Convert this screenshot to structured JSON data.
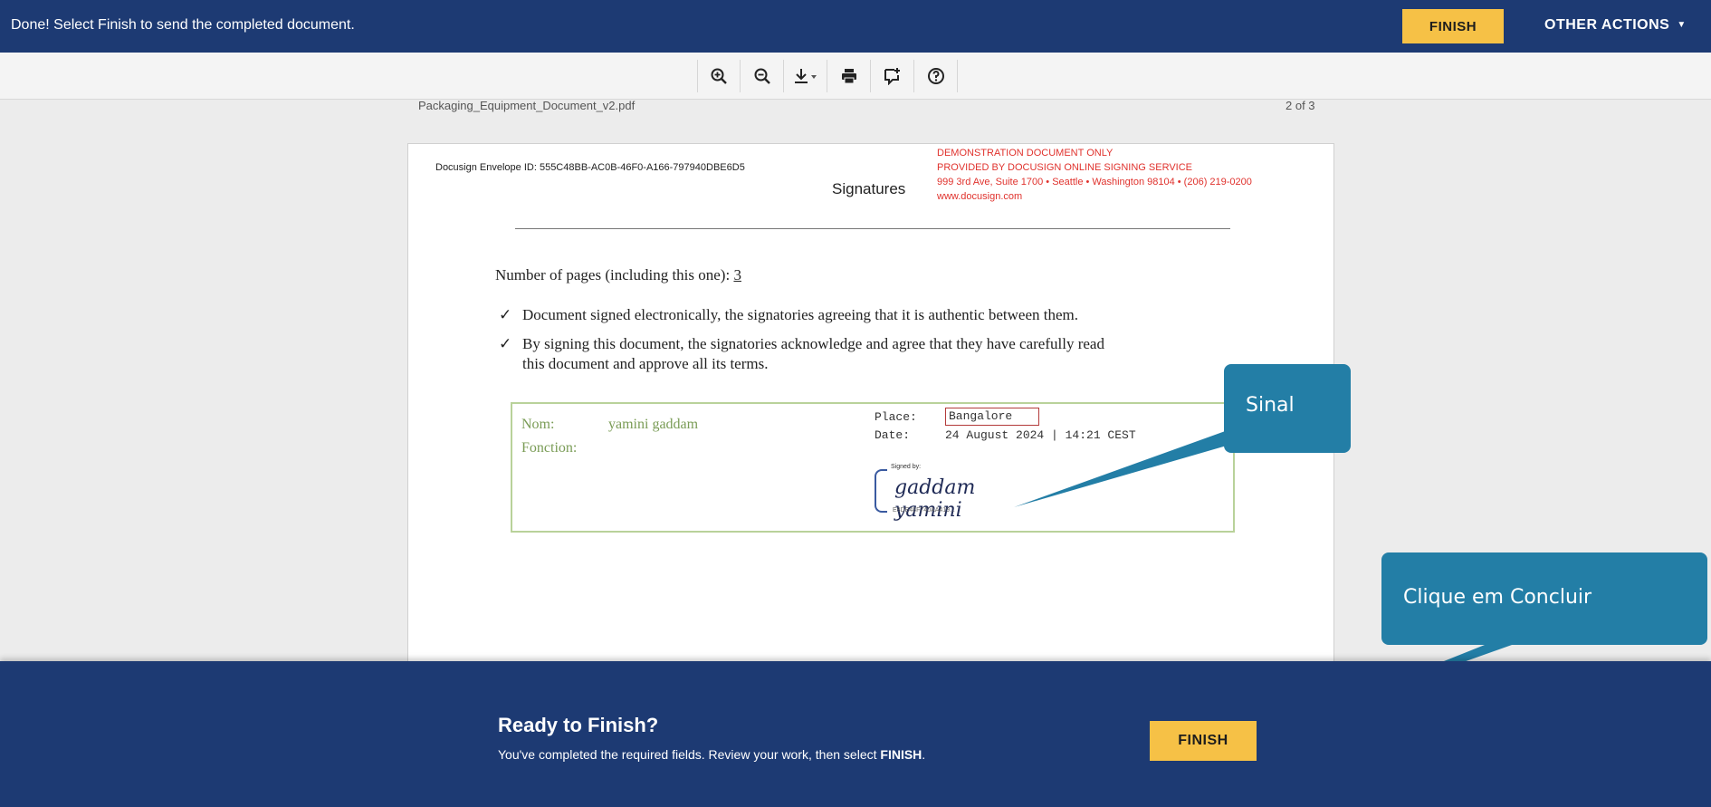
{
  "topbar": {
    "message": "Done! Select Finish to send the completed document.",
    "finish_label": "FINISH",
    "other_actions_label": "OTHER ACTIONS",
    "background": "#1d3a73",
    "accent": "#f6c146"
  },
  "toolbar": {
    "tools": [
      {
        "icon": "zoom-in-icon"
      },
      {
        "icon": "zoom-out-icon"
      },
      {
        "icon": "download-icon"
      },
      {
        "icon": "print-icon"
      },
      {
        "icon": "add-comment-icon"
      },
      {
        "icon": "help-icon"
      }
    ]
  },
  "document": {
    "filename": "Packaging_Equipment_Document_v2.pdf",
    "page_indicator": "2 of 3",
    "envelope_id": "Docusign Envelope ID: 555C48BB-AC0B-46F0-A166-797940DBE6D5",
    "demo_notice": [
      "DEMONSTRATION DOCUMENT ONLY",
      "PROVIDED BY DOCUSIGN ONLINE SIGNING SERVICE",
      "999 3rd Ave, Suite 1700  • Seattle • Washington 98104 • (206) 219-0200",
      "www.docusign.com"
    ],
    "section_title": "Signatures",
    "pages_line_prefix": "Number of pages (including this one): ",
    "pages_count": "3",
    "checks": [
      "Document signed electronically, the signatories agreeing that it is authentic between them.",
      "By signing this document, the signatories acknowledge and agree that they have carefully read this document and approve all its terms."
    ],
    "tick": "✓",
    "signature_block": {
      "nom_label": "Nom:",
      "nom_value": "yamini gaddam",
      "fonction_label": "Fonction:",
      "place_label": "Place:",
      "place_value": "Bangalore",
      "date_label": "Date:",
      "date_value": "24 August 2024 | 14:21 CEST",
      "signed_by_label": "Signed by:",
      "signature_text": "gaddam yamini",
      "signature_id": "E8DE48F740AA419..."
    }
  },
  "callouts": {
    "sign": "Sinal",
    "finish": "Clique em Concluir"
  },
  "bottom_banner": {
    "title": "Ready to Finish?",
    "subtitle_prefix": "You've completed the required fields. Review your work, then select ",
    "subtitle_bold": "FINISH",
    "subtitle_suffix": ".",
    "finish_label": "FINISH"
  }
}
